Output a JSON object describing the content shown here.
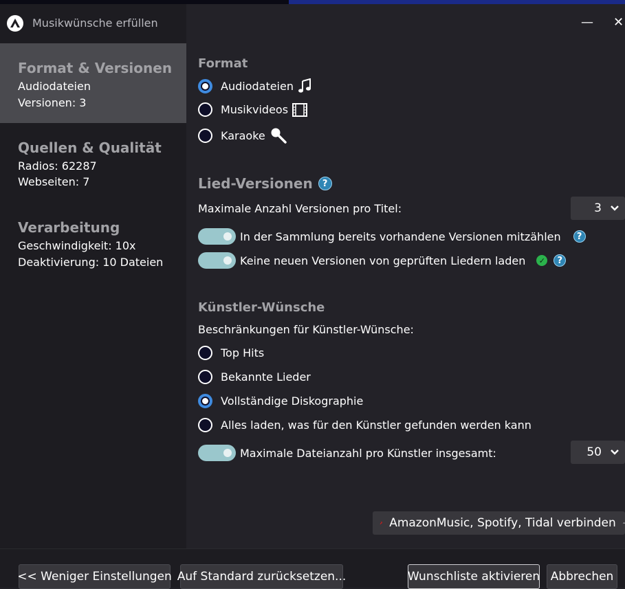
{
  "window": {
    "title": "Musikwünsche erfüllen",
    "minimize_label": "—",
    "close_label": "✕"
  },
  "sidebar": {
    "sections": [
      {
        "title": "Format & Versionen",
        "lines": [
          "Audiodateien",
          "Versionen: 3"
        ],
        "active": true
      },
      {
        "title": "Quellen & Qualität",
        "lines": [
          "Radios: 62287",
          "Webseiten: 7"
        ],
        "active": false
      },
      {
        "title": "Verarbeitung",
        "lines": [
          "Geschwindigkeit: 10x",
          "Deaktivierung: 10 Dateien"
        ],
        "active": false
      }
    ]
  },
  "format": {
    "title": "Format",
    "options": [
      {
        "label": "Audiodateien",
        "selected": true,
        "icon": "music-note-icon"
      },
      {
        "label": "Musikvideos",
        "selected": false,
        "icon": "film-icon"
      },
      {
        "label": "Karaoke",
        "selected": false,
        "icon": "microphone-icon"
      }
    ]
  },
  "versions": {
    "title": "Lied-Versionen",
    "help": "?",
    "max_label": "Maximale Anzahl Versionen pro Titel:",
    "max_value": "3",
    "toggle1": {
      "label": "In der Sammlung bereits vorhandene Versionen mitzählen",
      "on": true
    },
    "toggle2": {
      "label": "Keine neuen Versionen von geprüften Liedern laden",
      "on": true
    },
    "check": "✓"
  },
  "artist": {
    "title": "Künstler-Wünsche",
    "restrictions_label": "Beschränkungen für Künstler-Wünsche:",
    "options": [
      {
        "label": "Top Hits",
        "selected": false
      },
      {
        "label": "Bekannte Lieder",
        "selected": false
      },
      {
        "label": "Vollständige Diskographie",
        "selected": true
      },
      {
        "label": "Alles laden, was für den Künstler gefunden werden kann",
        "selected": false
      }
    ],
    "max_files_label": "Maximale Dateianzahl pro Künstler insgesamt:",
    "max_files_value": "50"
  },
  "connect": {
    "label": "AmazonMusic, Spotify, Tidal verbinden"
  },
  "footer": {
    "less_settings": "<< Weniger Einstellungen",
    "reset": "Auf Standard zurücksetzen...",
    "activate": "Wunschliste aktivieren",
    "cancel": "Abbrechen"
  },
  "colors": {
    "background": "#232228",
    "sidebar": "#1d1c21",
    "sidebar_active": "#4a4a4f",
    "radio_selected": "#3f8be0",
    "toggle": "#9ac7cc",
    "help": "#2f86b5",
    "check": "#2bb24c",
    "connect_arrow": "#e01818"
  }
}
